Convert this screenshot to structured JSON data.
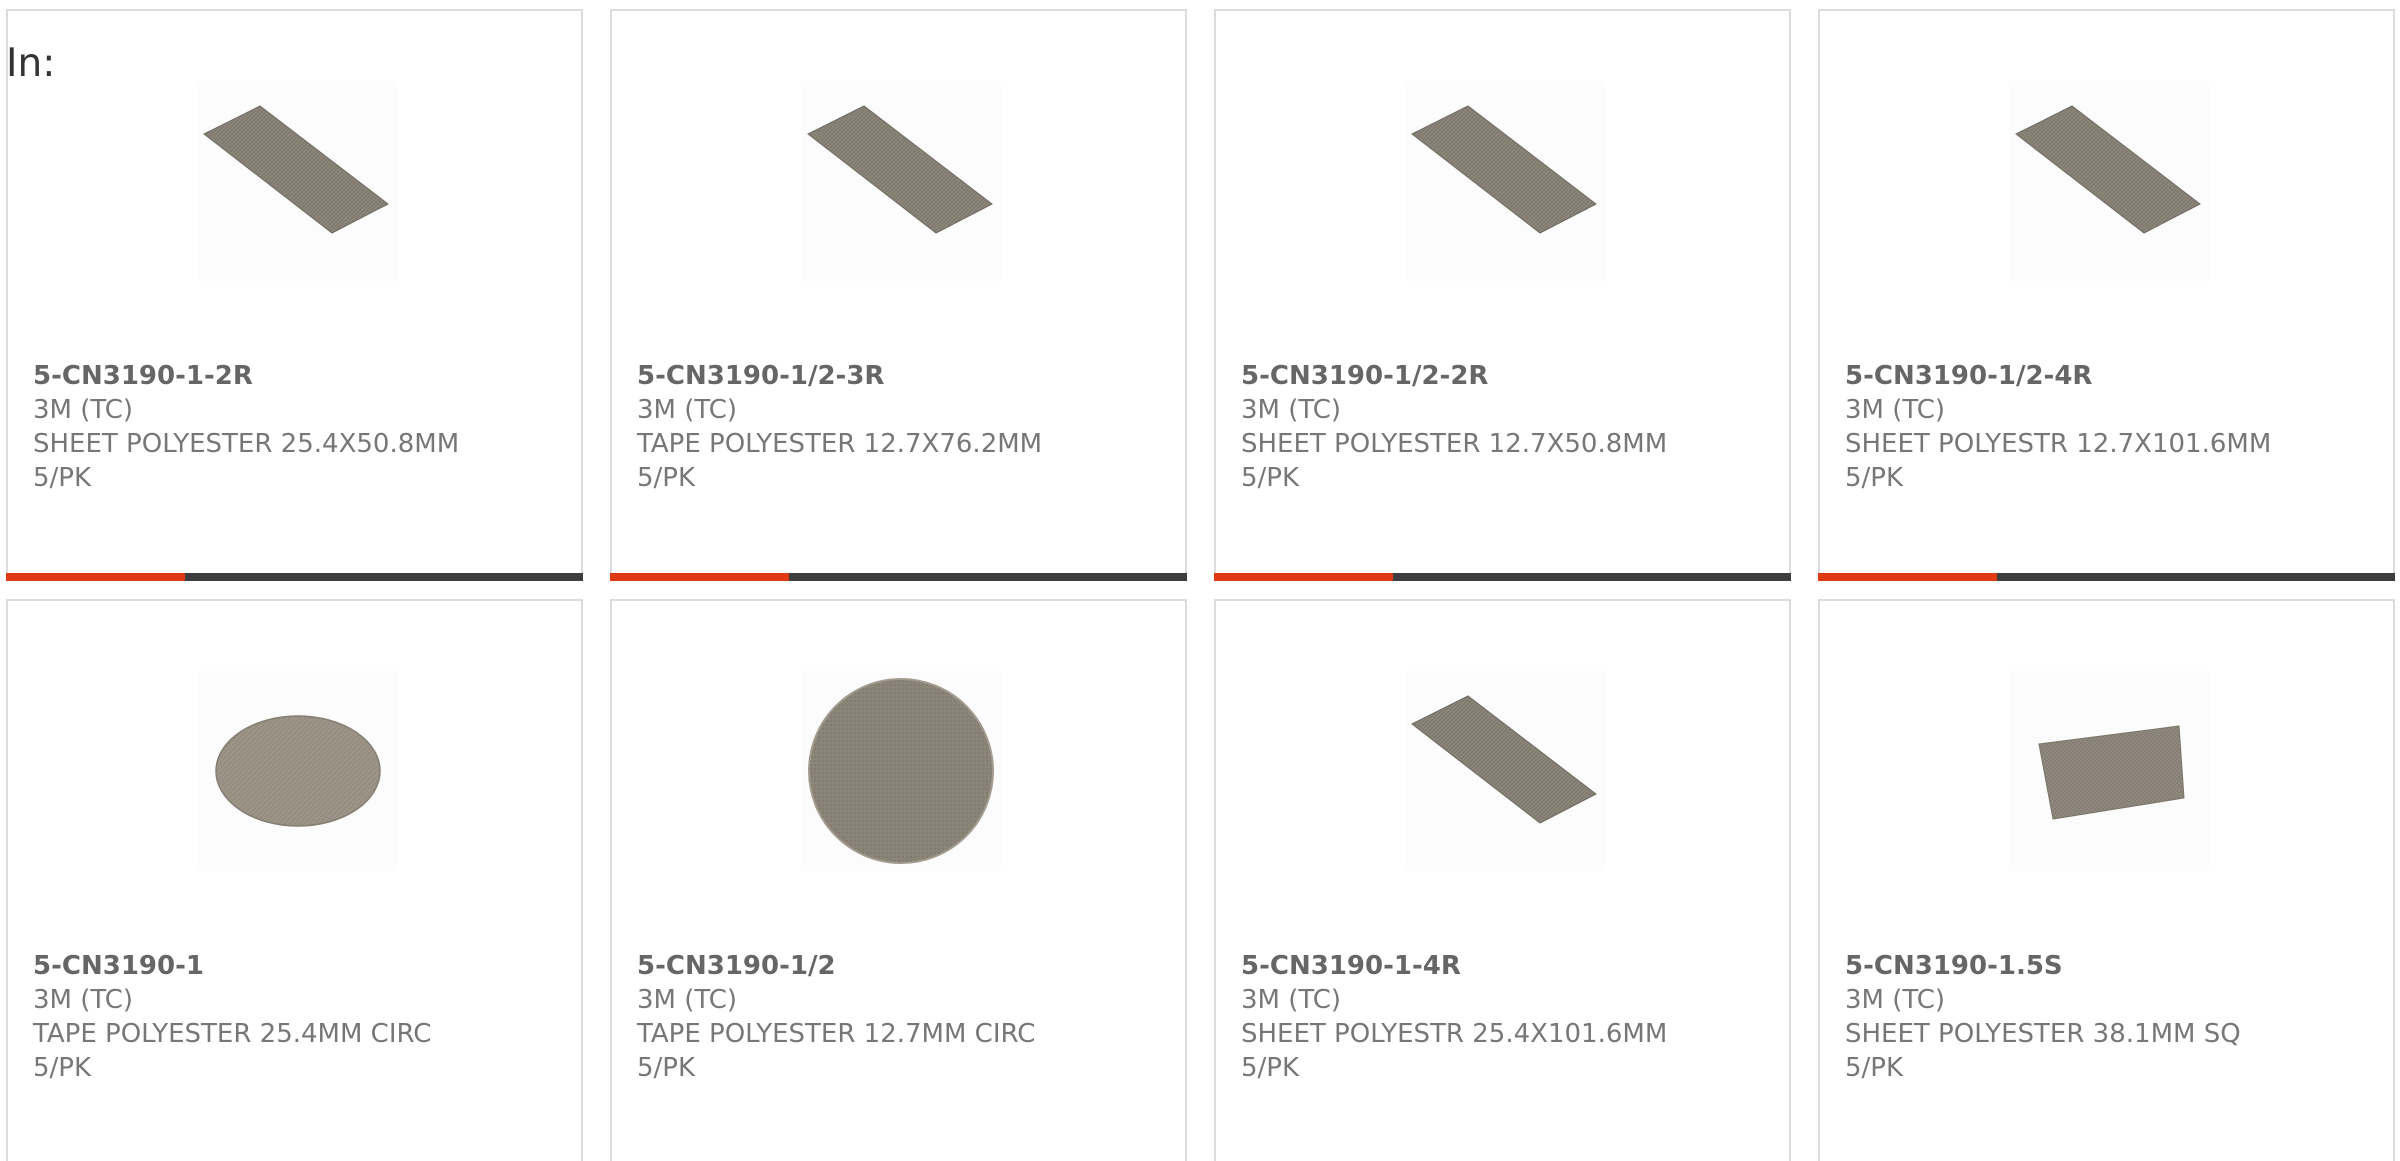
{
  "heading": "In:",
  "colors": {
    "accent": "#e03a12",
    "bar_track": "#3d3d3d",
    "material": "#8a8479",
    "card_border": "#dcdcdc"
  },
  "products": [
    {
      "part_number": "5-CN3190-1-2R",
      "brand": "3M (TC)",
      "description": "SHEET POLYESTER 25.4X50.8MM",
      "pack": "5/PK",
      "image_icon": "polyester-strip-image",
      "accent_fraction": 0.31
    },
    {
      "part_number": "5-CN3190-1/2-3R",
      "brand": "3M (TC)",
      "description": "TAPE POLYESTER 12.7X76.2MM",
      "pack": "5/PK",
      "image_icon": "polyester-strip-image",
      "accent_fraction": 0.31
    },
    {
      "part_number": "5-CN3190-1/2-2R",
      "brand": "3M (TC)",
      "description": "SHEET POLYESTER 12.7X50.8MM",
      "pack": "5/PK",
      "image_icon": "polyester-strip-image",
      "accent_fraction": 0.31
    },
    {
      "part_number": "5-CN3190-1/2-4R",
      "brand": "3M (TC)",
      "description": "SHEET POLYESTR 12.7X101.6MM",
      "pack": "5/PK",
      "image_icon": "polyester-strip-image",
      "accent_fraction": 0.31
    },
    {
      "part_number": "5-CN3190-1",
      "brand": "3M (TC)",
      "description": "TAPE POLYESTER 25.4MM CIRC",
      "pack": "5/PK",
      "image_icon": "polyester-ellipse-image"
    },
    {
      "part_number": "5-CN3190-1/2",
      "brand": "3M (TC)",
      "description": "TAPE POLYESTER 12.7MM CIRC",
      "pack": "5/PK",
      "image_icon": "polyester-disc-image"
    },
    {
      "part_number": "5-CN3190-1-4R",
      "brand": "3M (TC)",
      "description": "SHEET POLYESTR 25.4X101.6MM",
      "pack": "5/PK",
      "image_icon": "polyester-strip-image"
    },
    {
      "part_number": "5-CN3190-1.5S",
      "brand": "3M (TC)",
      "description": "SHEET POLYESTER 38.1MM SQ",
      "pack": "5/PK",
      "image_icon": "polyester-square-image"
    }
  ]
}
